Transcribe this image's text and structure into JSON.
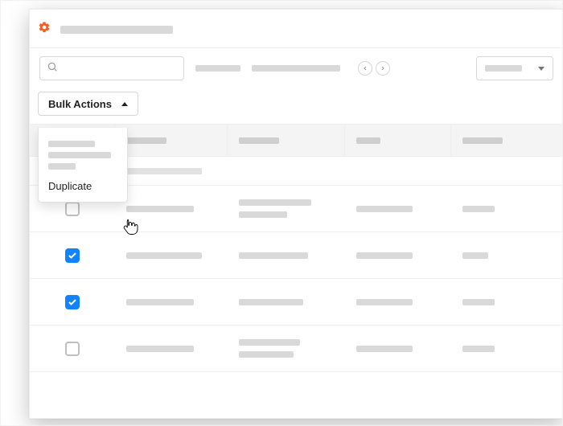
{
  "toolbar": {
    "search_placeholder": "",
    "bulk_actions_label": "Bulk Actions"
  },
  "bulk_menu": {
    "items": [
      "",
      "",
      "",
      "Duplicate"
    ],
    "hovered": "Duplicate"
  },
  "table": {
    "rows": [
      {
        "checked": false
      },
      {
        "checked": true
      },
      {
        "checked": true
      },
      {
        "checked": false
      }
    ]
  },
  "colors": {
    "accent": "#ff5a1f",
    "primary": "#1283ff"
  }
}
